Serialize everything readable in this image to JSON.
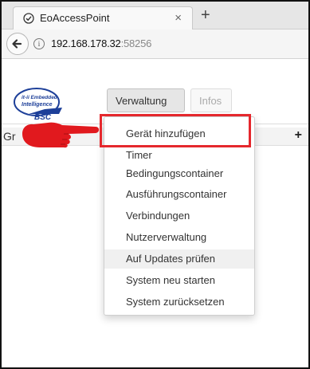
{
  "browser": {
    "tab_title": "EoAccessPoint",
    "tab_close": "×",
    "new_tab": "+",
    "url_host": "192.168.178.32",
    "url_port": ":58256",
    "info_glyph": "i"
  },
  "logo": {
    "line1": "it-ii Embedded",
    "line2": "Intelligence",
    "line3": "BSC"
  },
  "nav": {
    "verwaltung_label": "Verwaltung",
    "infos_label": "Infos"
  },
  "list_header": {
    "text": "Gr",
    "add": "+"
  },
  "menu": {
    "items": [
      {
        "label": "Gerät hinzufügen"
      },
      {
        "label": "Timer"
      },
      {
        "label": "Bedingungscontainer"
      },
      {
        "label": "Ausführungscontainer"
      },
      {
        "label": "Verbindungen"
      },
      {
        "label": "Nutzerverwaltung"
      },
      {
        "label": "Auf Updates prüfen"
      },
      {
        "label": "System neu starten"
      },
      {
        "label": "System zurücksetzen"
      }
    ],
    "hovered_index": 6
  },
  "colors": {
    "highlight": "#e5282d",
    "logo_blue": "#1d3f99"
  },
  "icons": {
    "favicon": "compass-icon",
    "back": "arrow-left-icon",
    "info": "info-circle-icon",
    "pointer": "hand-pointer-icon",
    "caret": "caret-down-icon",
    "add": "plus-icon"
  }
}
